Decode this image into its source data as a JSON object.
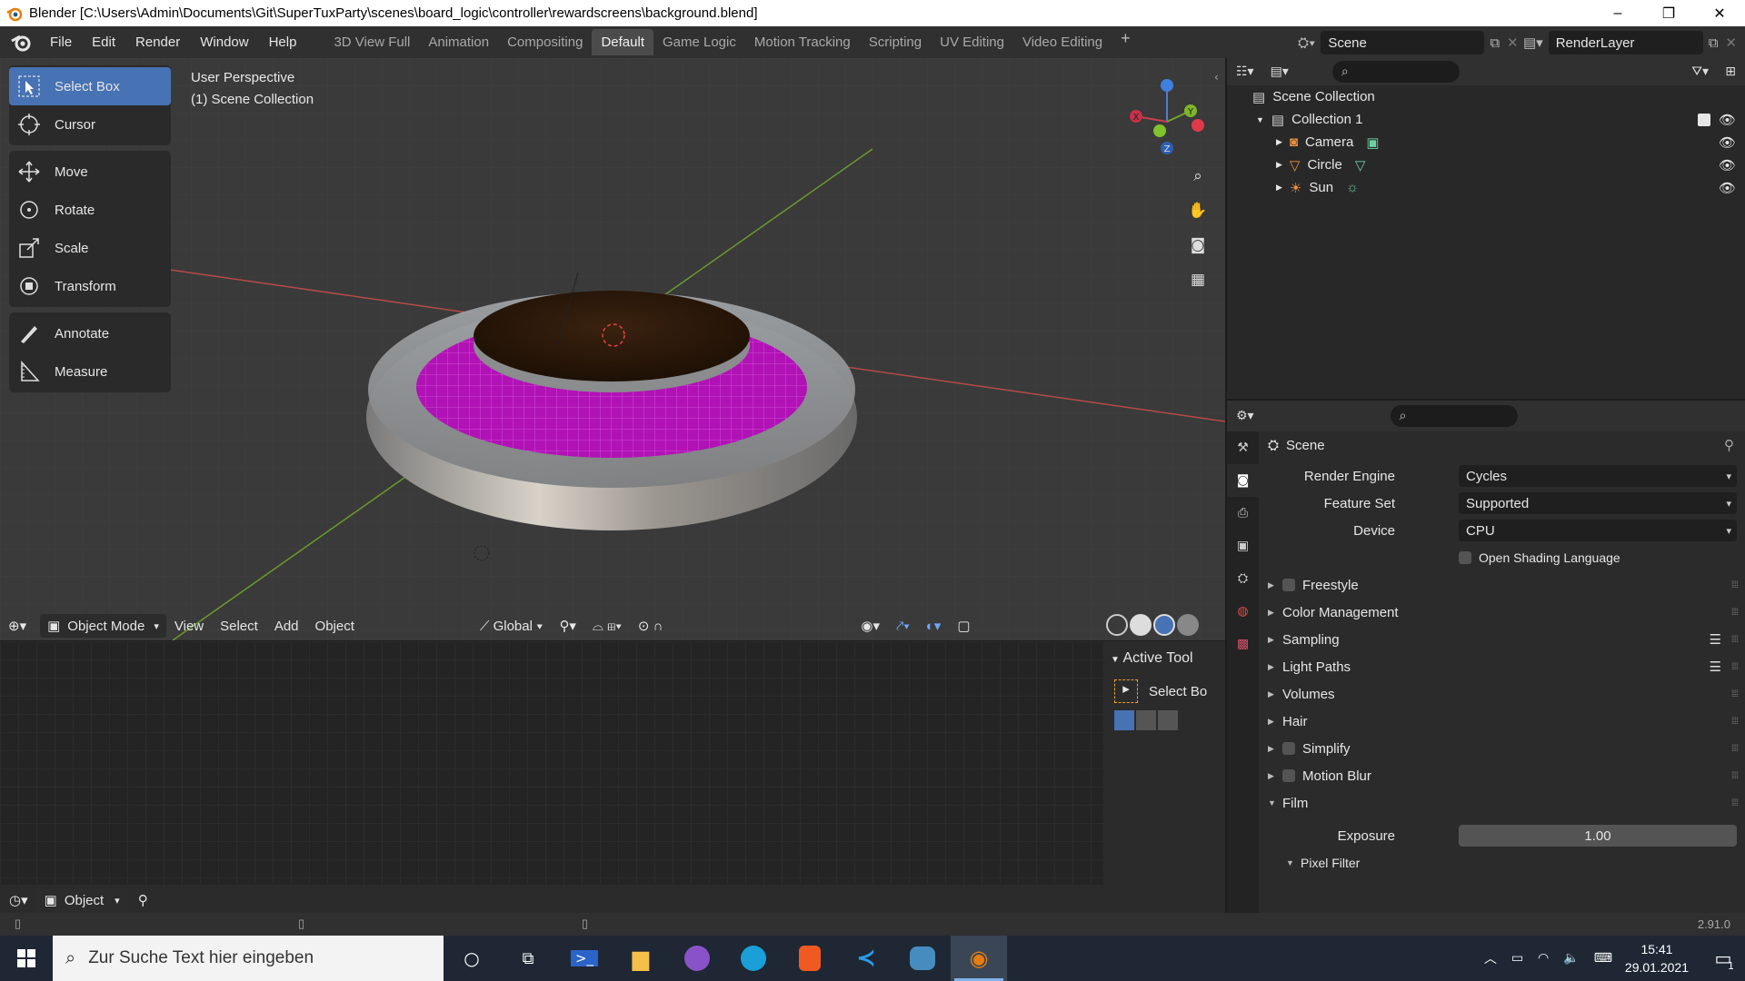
{
  "window": {
    "title": "Blender [C:\\Users\\Admin\\Documents\\Git\\SuperTuxParty\\scenes\\board_logic\\controller\\rewardscreens\\background.blend]",
    "controls": [
      "–",
      "❐",
      "✕"
    ]
  },
  "menu": {
    "items": [
      "File",
      "Edit",
      "Render",
      "Window",
      "Help"
    ]
  },
  "workspaces": {
    "tabs": [
      "3D View Full",
      "Animation",
      "Compositing",
      "Default",
      "Game Logic",
      "Motion Tracking",
      "Scripting",
      "UV Editing",
      "Video Editing"
    ],
    "active": "Default",
    "add_label": "+"
  },
  "scene_selector": {
    "value": "Scene"
  },
  "layer_selector": {
    "value": "RenderLayer"
  },
  "viewport": {
    "perspective": "User Perspective",
    "collection": "(1) Scene Collection",
    "tools": [
      {
        "label": "Select Box"
      },
      {
        "label": "Cursor"
      },
      {
        "label": "Move"
      },
      {
        "label": "Rotate"
      },
      {
        "label": "Scale"
      },
      {
        "label": "Transform"
      },
      {
        "label": "Annotate"
      },
      {
        "label": "Measure"
      }
    ],
    "gizmo_axes": {
      "x": "X",
      "y": "Y",
      "z": "Z"
    },
    "colors": {
      "grid_red": "#b54a4a",
      "grid_green": "#6a9a2e",
      "ring_magenta": "#b112b5",
      "top_brown": "#2a1608"
    }
  },
  "viewport_header": {
    "mode": "Object Mode",
    "menus": [
      "View",
      "Select",
      "Add",
      "Object"
    ],
    "transform_orientation": "Global"
  },
  "active_tool_panel": {
    "title": "Active Tool",
    "tool": "Select Bo"
  },
  "timeline_header": {
    "mode": "Object"
  },
  "outliner": {
    "root": "Scene Collection",
    "collection": "Collection 1",
    "objects": [
      {
        "name": "Camera",
        "icon": "camera-icon",
        "color": "#e8923c"
      },
      {
        "name": "Circle",
        "icon": "mesh-icon",
        "color": "#e8923c"
      },
      {
        "name": "Sun",
        "icon": "light-icon",
        "color": "#e8923c"
      }
    ]
  },
  "properties": {
    "context": "Scene",
    "fields": [
      {
        "label": "Render Engine",
        "value": "Cycles"
      },
      {
        "label": "Feature Set",
        "value": "Supported"
      },
      {
        "label": "Device",
        "value": "CPU"
      }
    ],
    "osl_label": "Open Shading Language",
    "panels": [
      {
        "label": "Freestyle",
        "checkbox": true
      },
      {
        "label": "Color Management",
        "checkbox": false
      },
      {
        "label": "Sampling",
        "checkbox": false
      },
      {
        "label": "Light Paths",
        "checkbox": false
      },
      {
        "label": "Volumes",
        "checkbox": false
      },
      {
        "label": "Hair",
        "checkbox": false
      },
      {
        "label": "Simplify",
        "checkbox": true
      },
      {
        "label": "Motion Blur",
        "checkbox": true
      }
    ],
    "film": {
      "label": "Film",
      "exposure_label": "Exposure",
      "exposure_value": "1.00",
      "pixel_filter": "Pixel Filter"
    }
  },
  "statusbar": {
    "version": "2.91.0"
  },
  "taskbar": {
    "search_placeholder": "Zur Suche Text hier eingeben",
    "time": "15:41",
    "date": "29.01.2021",
    "notification_count": "1"
  }
}
